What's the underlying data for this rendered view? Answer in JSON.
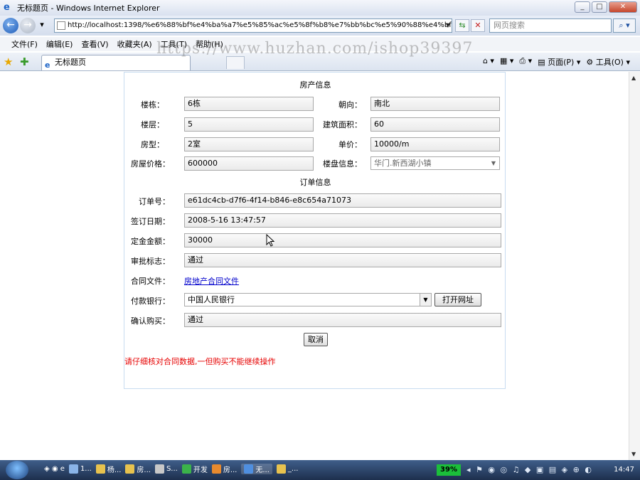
{
  "window": {
    "title": "无标题页 - Windows Internet Explorer",
    "controls": [
      "_",
      "□",
      "✕"
    ]
  },
  "address_bar": {
    "url": "http://localhost:1398/%e6%88%bf%e4%ba%a7%e5%85%ac%e5%8f%b8%e7%bb%bc%e5%90%88%e4%bf%a1%e",
    "search_placeholder": "网页搜索"
  },
  "menu": [
    "文件(F)",
    "编辑(E)",
    "查看(V)",
    "收藏夹(A)",
    "工具(T)",
    "帮助(H)"
  ],
  "tab": {
    "title": "无标题页"
  },
  "command_bar": {
    "page_label": "页面(P)",
    "tools_label": "工具(O)"
  },
  "watermark": "https://www.huzhan.com/ishop39397",
  "property_info": {
    "section_title": "房产信息",
    "fields": {
      "building_label": "楼栋：",
      "building_value": "6栋",
      "orientation_label": "朝向：",
      "orientation_value": "南北",
      "floor_label": "楼层：",
      "floor_value": "5",
      "area_label": "建筑面积：",
      "area_value": "60",
      "layout_label": "房型：",
      "layout_value": "2室",
      "unit_price_label": "单价：",
      "unit_price_value": "10000/m",
      "price_label": "房屋价格：",
      "price_value": "600000",
      "estate_label": "楼盘信息：",
      "estate_value": "华门.新西湖小镇"
    }
  },
  "order_info": {
    "section_title": "订单信息",
    "order_id_label": "订单号：",
    "order_id_value": "e61dc4cb-d7f6-4f14-b846-e8c654a71073",
    "sign_date_label": "签订日期：",
    "sign_date_value": "2008-5-16 13:47:57",
    "deposit_label": "定金金额：",
    "deposit_value": "30000",
    "approval_label": "审批标志：",
    "approval_value": "通过",
    "contract_label": "合同文件：",
    "contract_link": "房地产合同文件",
    "bank_label": "付款银行：",
    "bank_value": "中国人民银行",
    "open_site_button": "打开网址",
    "confirm_label": "确认购买：",
    "confirm_value": "通过",
    "cancel_button": "取消",
    "warning": "请仔细核对合同数据,一但购买不能继续操作"
  },
  "taskbar": {
    "items": [
      "1...",
      "杨...",
      "房...",
      "S...",
      "开发",
      "房...",
      "无...",
      "_..."
    ],
    "meter": "39%",
    "clock": "14:47"
  }
}
